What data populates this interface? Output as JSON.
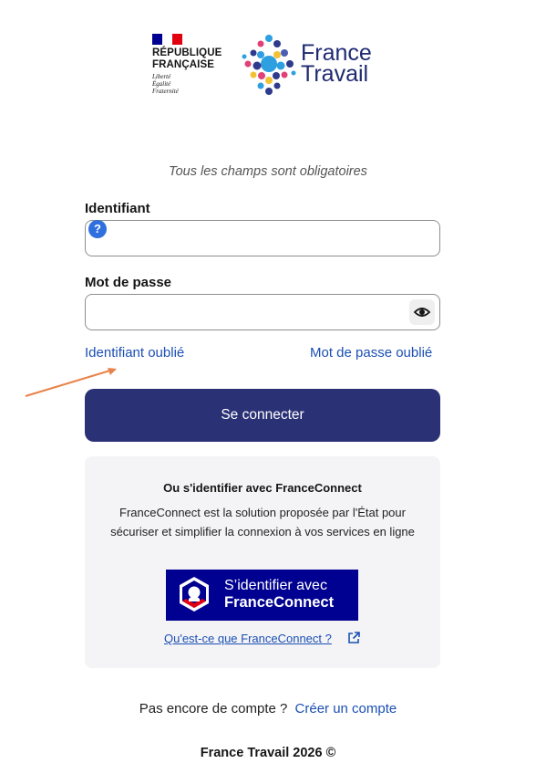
{
  "header": {
    "republique_line1": "RÉPUBLIQUE",
    "republique_line2": "FRANÇAISE",
    "motto_1": "Liberté",
    "motto_2": "Égalité",
    "motto_3": "Fraternité",
    "brand_line1": "France",
    "brand_line2": "Travail"
  },
  "form": {
    "mandatory_notice": "Tous les champs sont obligatoires",
    "identifier_label": "Identifiant",
    "identifier_value": "",
    "help_glyph": "?",
    "password_label": "Mot de passe",
    "password_value": "",
    "forgot_identifier": "Identifiant oublié",
    "forgot_password": "Mot de passe oublié",
    "submit_label": "Se connecter"
  },
  "franceconnect": {
    "title": "Ou s'identifier avec FranceConnect",
    "description": "FranceConnect est la solution proposée par l'État pour sécuriser et simplifier la connexion à vos services en ligne",
    "button_line1": "S’identifier avec",
    "button_line2": "FranceConnect",
    "info_link": "Qu'est-ce que FranceConnect ?"
  },
  "signup": {
    "prompt": "Pas encore de compte ?",
    "link": "Créer un compte"
  },
  "footer": {
    "copyright": "France Travail 2026 ©"
  },
  "colors": {
    "primary_button": "#2a3175",
    "link": "#1b4fb3",
    "franceconnect_blue": "#000091",
    "annotation_arrow": "#e8834a"
  },
  "icons": {
    "help": "help-icon",
    "password_visibility": "eye-icon",
    "external_link": "external-link-icon"
  }
}
